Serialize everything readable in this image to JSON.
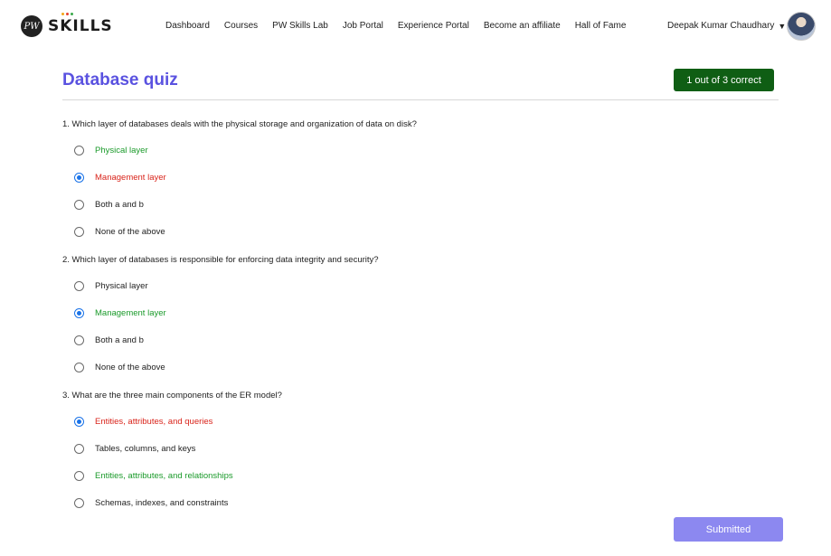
{
  "header": {
    "logo_text": "SKILLS",
    "logo_mark": "PW",
    "logo_dot_colors": [
      "#f2a516",
      "#e7402e",
      "#3aa94b"
    ],
    "nav": [
      "Dashboard",
      "Courses",
      "PW Skills Lab",
      "Job Portal",
      "Experience Portal",
      "Become an affiliate",
      "Hall of Fame"
    ],
    "user_name": "Deepak Kumar Chaudhary",
    "user_caret": "▼"
  },
  "quiz": {
    "title": "Database quiz",
    "score": "1 out of 3 correct",
    "submit_label": "Submitted",
    "questions": [
      {
        "text": "1. Which layer of databases deals with the physical storage and organization of data on disk?",
        "options": [
          {
            "label": "Physical layer",
            "state": "correct",
            "checked": false
          },
          {
            "label": "Management layer",
            "state": "wrong",
            "checked": true
          },
          {
            "label": "Both a and b",
            "state": "normal",
            "checked": false
          },
          {
            "label": "None of the above",
            "state": "normal",
            "checked": false
          }
        ]
      },
      {
        "text": "2. Which layer of databases is responsible for enforcing data integrity and security?",
        "options": [
          {
            "label": "Physical layer",
            "state": "normal",
            "checked": false
          },
          {
            "label": "Management layer",
            "state": "correct",
            "checked": true
          },
          {
            "label": "Both a and b",
            "state": "normal",
            "checked": false
          },
          {
            "label": "None of the above",
            "state": "normal",
            "checked": false
          }
        ]
      },
      {
        "text": "3. What are the three main components of the ER model?",
        "options": [
          {
            "label": "Entities, attributes, and queries",
            "state": "wrong",
            "checked": true
          },
          {
            "label": "Tables, columns, and keys",
            "state": "normal",
            "checked": false
          },
          {
            "label": "Entities, attributes, and relationships",
            "state": "correct",
            "checked": false
          },
          {
            "label": "Schemas, indexes, and constraints",
            "state": "normal",
            "checked": false
          }
        ]
      }
    ]
  },
  "colors": {
    "title": "#5a52e0",
    "score_bg": "#0f5e14",
    "correct": "#1a9a2a",
    "wrong": "#d9241b",
    "submit_bg": "#8c88f0"
  }
}
